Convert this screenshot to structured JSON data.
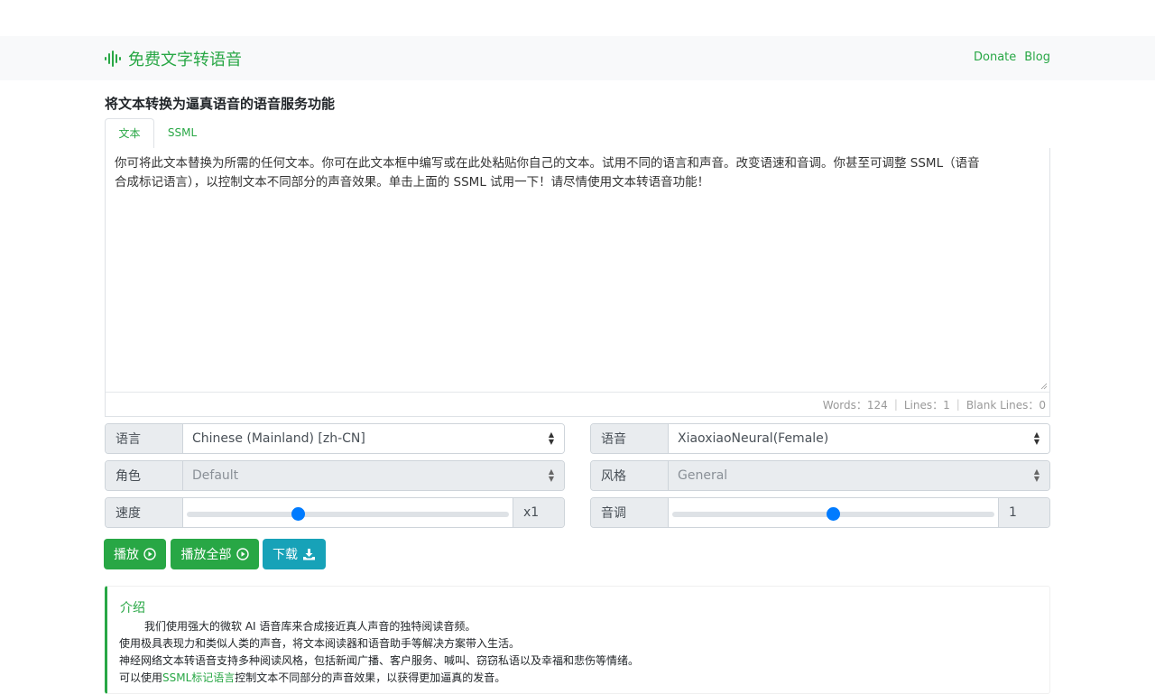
{
  "navbar": {
    "brand": "免费文字转语音",
    "links": [
      "Donate",
      "Blog"
    ]
  },
  "heading": "将文本转换为逼真语音的语音服务功能",
  "tabs": [
    "文本",
    "SSML"
  ],
  "editor": {
    "line1": "你可将此文本替换为所需的任何文本。你可在此文本框中编写或在此处粘贴你自己的文本。试用不同的语言和声音。改变语速和音调。你甚至可调整 SSML（语音",
    "line2": "合成标记语言），以控制文本不同部分的声音效果。单击上面的 SSML 试用一下！请尽情使用文本转语音功能！"
  },
  "status": {
    "words": "Words：124",
    "lines": "Lines：1",
    "blank": "Blank Lines：0"
  },
  "controls": {
    "language": {
      "label": "语言",
      "value": "Chinese (Mainland) [zh-CN]"
    },
    "voice": {
      "label": "语音",
      "value": "XiaoxiaoNeural(Female)"
    },
    "role": {
      "label": "角色",
      "value": "Default"
    },
    "style": {
      "label": "风格",
      "value": "General"
    },
    "speed": {
      "label": "速度",
      "value": "x1",
      "level": 0.34
    },
    "pitch": {
      "label": "音调",
      "value": "1",
      "level": 0.5
    }
  },
  "buttons": {
    "play": "播放",
    "play_all": "播放全部",
    "download": "下载"
  },
  "intro": {
    "title": "介绍",
    "line1": "我们使用强大的微软 AI 语音库来合成接近真人声音的独特阅读音频。",
    "line2": "使用极具表现力和类似人类的声音，将文本阅读器和语音助手等解决方案带入生活。",
    "line3": "神经网络文本转语音支持多种阅读风格，包括新闻广播、客户服务、喊叫、窃窃私语以及幸福和悲伤等情绪。",
    "line4_pre": "可以使用",
    "line4_link": "SSML标记语言",
    "line4_post": "控制文本不同部分的声音效果，以获得更加逼真的发音。"
  },
  "colors": {
    "brand": "#28a745",
    "download": "#17a2b8",
    "slider": "#007bff"
  },
  "icons": {
    "brand": "sound-wave-icon",
    "play": "play-circle-icon",
    "download": "download-icon",
    "select": "select-arrows-icon"
  }
}
